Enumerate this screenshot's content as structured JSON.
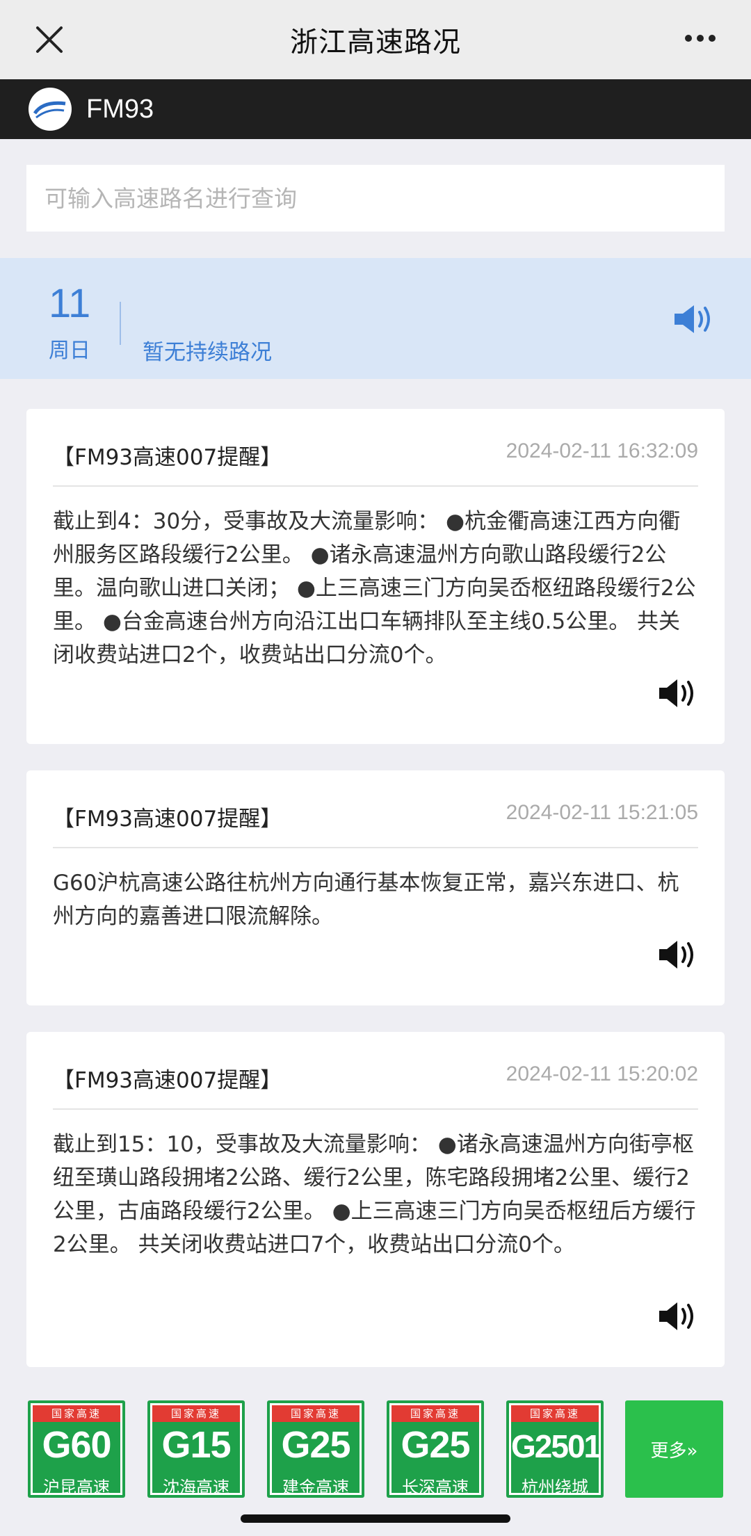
{
  "window": {
    "title": "浙江高速路况"
  },
  "brand": {
    "name": "FM93"
  },
  "search": {
    "placeholder": "可输入高速路名进行查询"
  },
  "summary": {
    "day": "11",
    "weekday": "周日",
    "status": "暂无持续路况"
  },
  "reports": [
    {
      "source": "【FM93高速007提醒】",
      "time": "2024-02-11 16:32:09",
      "text": "截止到4：30分，受事故及大流量影响： ●杭金衢高速江西方向衢州服务区路段缓行2公里。 ●诸永高速温州方向歌山路段缓行2公里。温向歌山进口关闭； ●上三高速三门方向吴岙枢纽路段缓行2公里。 ●台金高速台州方向沿江出口车辆排队至主线0.5公里。 共关闭收费站进口2个，收费站出口分流0个。"
    },
    {
      "source": "【FM93高速007提醒】",
      "time": "2024-02-11 15:21:05",
      "text": "G60沪杭高速公路往杭州方向通行基本恢复正常，嘉兴东进口、杭州方向的嘉善进口限流解除。"
    },
    {
      "source": "【FM93高速007提醒】",
      "time": "2024-02-11 15:20:02",
      "text": "截止到15：10，受事故及大流量影响： ●诸永高速温州方向街亭枢纽至璜山路段拥堵2公路、缓行2公里，陈宅路段拥堵2公里、缓行2公里，古庙路段缓行2公里。 ●上三高速三门方向吴岙枢纽后方缓行2公里。 共关闭收费站进口7个，收费站出口分流0个。"
    }
  ],
  "roads": [
    {
      "cap": "国家高速",
      "code": "G60",
      "name": "沪昆高速"
    },
    {
      "cap": "国家高速",
      "code": "G15",
      "name": "沈海高速"
    },
    {
      "cap": "国家高速",
      "code": "G25",
      "name": "建金高速"
    },
    {
      "cap": "国家高速",
      "code": "G25",
      "name": "长深高速"
    },
    {
      "cap": "国家高速",
      "code": "G2501",
      "name": "杭州绕城"
    }
  ],
  "more_label": "更多»",
  "colors": {
    "accent": "#3d7fd6",
    "highway_green": "#1ea14a",
    "highway_red": "#e23b33",
    "more_green": "#2bc04c"
  }
}
